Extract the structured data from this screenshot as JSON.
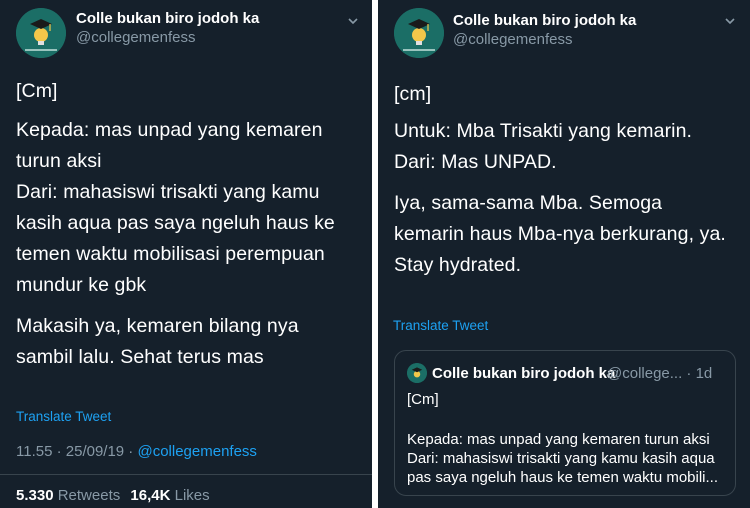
{
  "colors": {
    "background": "#15202b",
    "text": "#ffffff",
    "muted": "#8899a6",
    "link": "#1da1f2",
    "border": "#38444d"
  },
  "left_tweet": {
    "display_name": "Colle bukan biro jodoh ka",
    "handle": "@collegemenfess",
    "avatar_icon": "graduation-cap-lightbulb-logo",
    "body_lines": [
      "[Cm]",
      "Kepada: mas unpad yang kemaren",
      "turun aksi",
      "Dari: mahasiswi trisakti yang kamu",
      "kasih aqua pas saya ngeluh haus ke",
      "temen waktu mobilisasi perempuan",
      "mundur ke gbk",
      "Makasih ya, kemaren bilang nya",
      "sambil lalu. Sehat terus mas"
    ],
    "translate_label": "Translate Tweet",
    "timestamp": "11.55 · 25/09/19 · ",
    "via": "@collegemenfess",
    "retweets_count": "5.330",
    "retweets_label": "Retweets",
    "likes_count": "16,4K",
    "likes_label": "Likes"
  },
  "right_tweet": {
    "display_name": "Colle bukan biro jodoh ka",
    "handle": "@collegemenfess",
    "avatar_icon": "graduation-cap-lightbulb-logo",
    "body_lines": [
      "[cm]",
      "Untuk: Mba Trisakti yang kemarin.",
      "Dari: Mas UNPAD.",
      "Iya, sama-sama Mba. Semoga",
      "kemarin haus Mba-nya berkurang, ya.",
      "Stay hydrated."
    ],
    "translate_label": "Translate Tweet",
    "quoted": {
      "display_name": "Colle bukan biro jodoh ka",
      "handle_and_time": "@college... · 1d",
      "lines": [
        "[Cm]",
        "Kepada: mas unpad yang kemaren turun aksi",
        "Dari: mahasiswi trisakti yang kamu kasih aqua",
        "pas saya ngeluh haus ke temen waktu mobili..."
      ]
    }
  }
}
